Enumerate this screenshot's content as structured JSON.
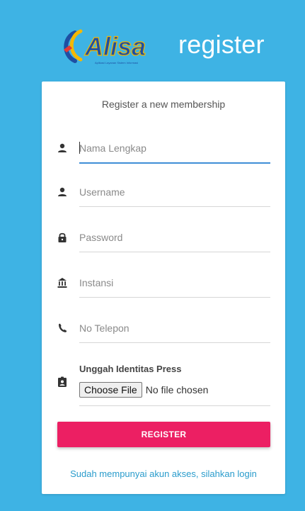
{
  "brand": {
    "logo_text": "Alisa",
    "logo_tagline": "Aplikasi Layanan Sistem Informasi",
    "suffix": "register",
    "logo_color": "#1e4fa3",
    "accent_color": "#f5b800"
  },
  "card": {
    "title": "Register a new membership"
  },
  "fields": [
    {
      "icon": "person-icon",
      "placeholder": "Nama Lengkap",
      "value": ""
    },
    {
      "icon": "person-icon",
      "placeholder": "Username",
      "value": ""
    },
    {
      "icon": "lock-icon",
      "placeholder": "Password",
      "value": ""
    },
    {
      "icon": "institution-icon",
      "placeholder": "Instansi",
      "value": ""
    },
    {
      "icon": "phone-icon",
      "placeholder": "No Telepon",
      "value": ""
    }
  ],
  "upload": {
    "icon": "id-badge-icon",
    "label": "Unggah Identitas Press",
    "button_label": "Choose File",
    "status": "No file chosen"
  },
  "actions": {
    "register_label": "REGISTER",
    "register_color": "#ec1f63",
    "login_link": "Sudah mempunyai akun akses, silahkan login"
  },
  "colors": {
    "background": "#3eb3e4",
    "focus_underline": "#3f8ed6",
    "link": "#2a9ccc"
  }
}
